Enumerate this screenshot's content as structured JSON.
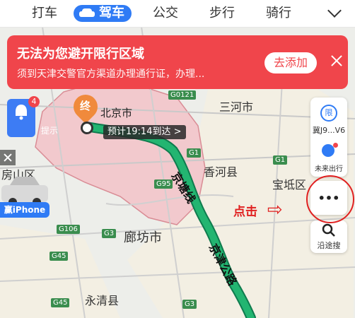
{
  "top_tabs": [
    {
      "label": "打车",
      "active": false
    },
    {
      "label": "驾车",
      "active": true
    },
    {
      "label": "公交",
      "active": false
    },
    {
      "label": "步行",
      "active": false
    },
    {
      "label": "骑行",
      "active": false
    }
  ],
  "banner": {
    "title": "无法为您避开限行区域",
    "subtitle": "须到天津交警官方渠道办理通行证，办理...",
    "add_button": "去添加"
  },
  "notice": {
    "label": "提示",
    "badge": "4"
  },
  "ad": {
    "label": "赢iPhone"
  },
  "route": {
    "end_label": "终",
    "eta": "预计19:14到达 >"
  },
  "right_panel": {
    "plate": "冀J9...V6",
    "future_trip": "未来出行",
    "more": "•••",
    "search_along": "沿途搜"
  },
  "annotation": {
    "text": "点击",
    "arrow": "⇨"
  },
  "map_labels": {
    "places": [
      "北京市",
      "三河市",
      "香河县",
      "宝坻区",
      "廊坊市",
      "永清县",
      "房山区",
      "京塘线",
      "京津公路"
    ],
    "road_badges": [
      "G0121",
      "G1",
      "G95",
      "G1",
      "G106",
      "G3",
      "G45",
      "G45",
      "G3"
    ]
  },
  "colors": {
    "accent": "#2f7bf5",
    "banner": "#f0454b",
    "route": "#1aa66b",
    "annot": "#e02020"
  }
}
